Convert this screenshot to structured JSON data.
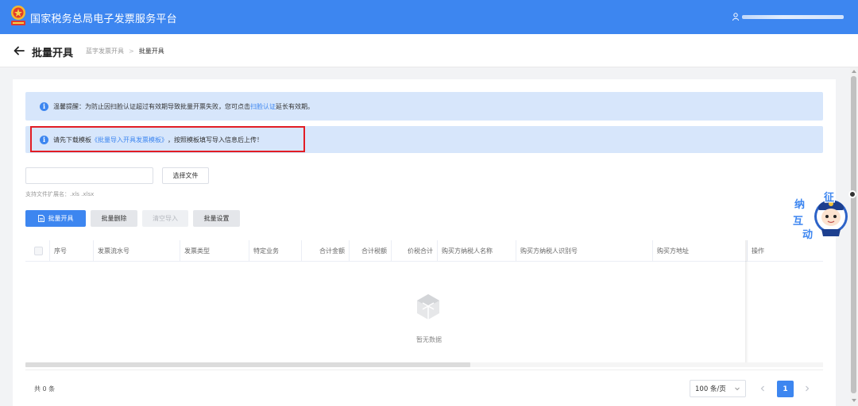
{
  "app": {
    "title": "国家税务总局电子发票服务平台"
  },
  "page": {
    "title": "批量开具",
    "breadcrumb": [
      "蓝字发票开具",
      "批量开具"
    ],
    "breadcrumb_sep": ">"
  },
  "notices": {
    "tip1_prefix": "温馨提醒：为防止因扫脸认证超过有效期导致批量开票失败，您可点击",
    "tip1_link": "扫脸认证",
    "tip1_suffix": "延长有效期。",
    "tip2_prefix": "请先下载模板",
    "tip2_link": "《批量导入开具发票模板》",
    "tip2_suffix": "，按照模板填写导入信息后上传！"
  },
  "upload": {
    "file_value": "",
    "choose_label": "选择文件",
    "hint": "支持文件扩展名：.xls .xlsx"
  },
  "actions": {
    "issue_label": "批量开具",
    "delete_label": "批量删除",
    "clear_label": "清空导入",
    "settings_label": "批量设置"
  },
  "table": {
    "columns": [
      "序号",
      "发票流水号",
      "发票类型",
      "特定业务",
      "合计金额",
      "合计税额",
      "价税合计",
      "购买方纳税人名称",
      "购买方纳税人识别号",
      "购买方地址",
      "操作"
    ],
    "empty_text": "暂无数据"
  },
  "pagination": {
    "total_text": "共 0 条",
    "page_size": "100 条/页",
    "current_page": "1"
  },
  "mascot": {
    "chars": [
      "征",
      "纳",
      "互",
      "动"
    ]
  },
  "colors": {
    "primary": "#3d86f0",
    "notice_bg": "#d7e6fb",
    "highlight": "#e21d24"
  },
  "icons": [
    "tax-emblem-icon",
    "user-icon",
    "back-arrow-icon",
    "info-icon",
    "document-icon",
    "box-empty-icon",
    "chevron-down-icon",
    "chevron-left-icon",
    "chevron-right-icon"
  ]
}
